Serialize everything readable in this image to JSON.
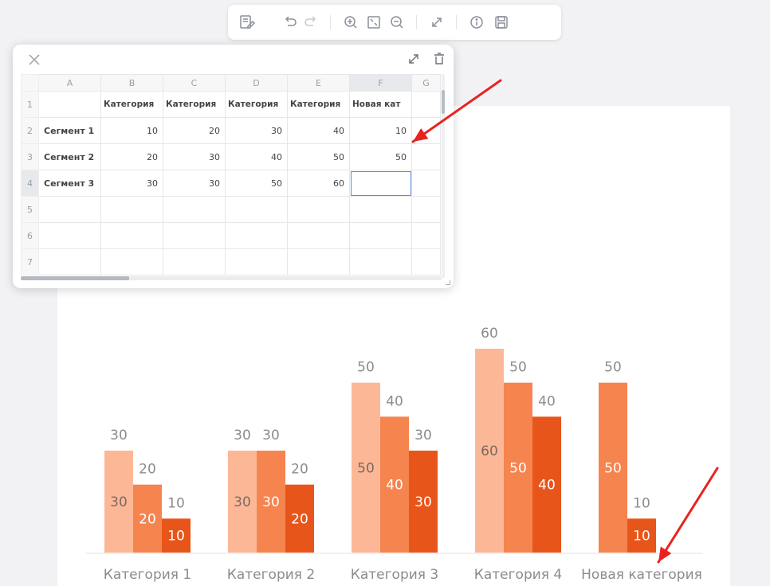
{
  "chart_data": {
    "type": "bar",
    "categories": [
      "Категория 1",
      "Категория 2",
      "Категория 3",
      "Категория 4",
      "Новая категория"
    ],
    "series": [
      {
        "values": [
          30,
          30,
          50,
          60,
          null
        ],
        "color": "#fcb896"
      },
      {
        "values": [
          20,
          30,
          40,
          50,
          50
        ],
        "color": "#f5844f"
      },
      {
        "values": [
          10,
          20,
          30,
          40,
          10
        ],
        "color": "#e8551a"
      }
    ],
    "ylim": [
      0,
      60
    ],
    "grid": false,
    "legend": "none"
  },
  "toolbar": {
    "icons": [
      "edit-data-icon",
      "undo-icon",
      "redo-icon",
      "zoom-in-icon",
      "fit-icon",
      "zoom-out-icon",
      "fullscreen-icon",
      "info-icon",
      "save-icon"
    ]
  },
  "sheet": {
    "col_headers": [
      "A",
      "B",
      "C",
      "D",
      "E",
      "F",
      "G"
    ],
    "row_numbers": [
      "1",
      "2",
      "3",
      "4",
      "5",
      "6",
      "7"
    ],
    "header_row": [
      "",
      "Категория",
      "Категория",
      "Категория",
      "Категория",
      "Новая кат"
    ],
    "rows": [
      {
        "label": "Сегмент 1",
        "values": [
          "10",
          "20",
          "30",
          "40",
          "10"
        ]
      },
      {
        "label": "Сегмент 2",
        "values": [
          "20",
          "30",
          "40",
          "50",
          "50"
        ]
      },
      {
        "label": "Сегмент 3",
        "values": [
          "30",
          "30",
          "50",
          "60",
          ""
        ]
      }
    ],
    "selected_cell": "F4"
  },
  "annotation_color": "#e8231f"
}
